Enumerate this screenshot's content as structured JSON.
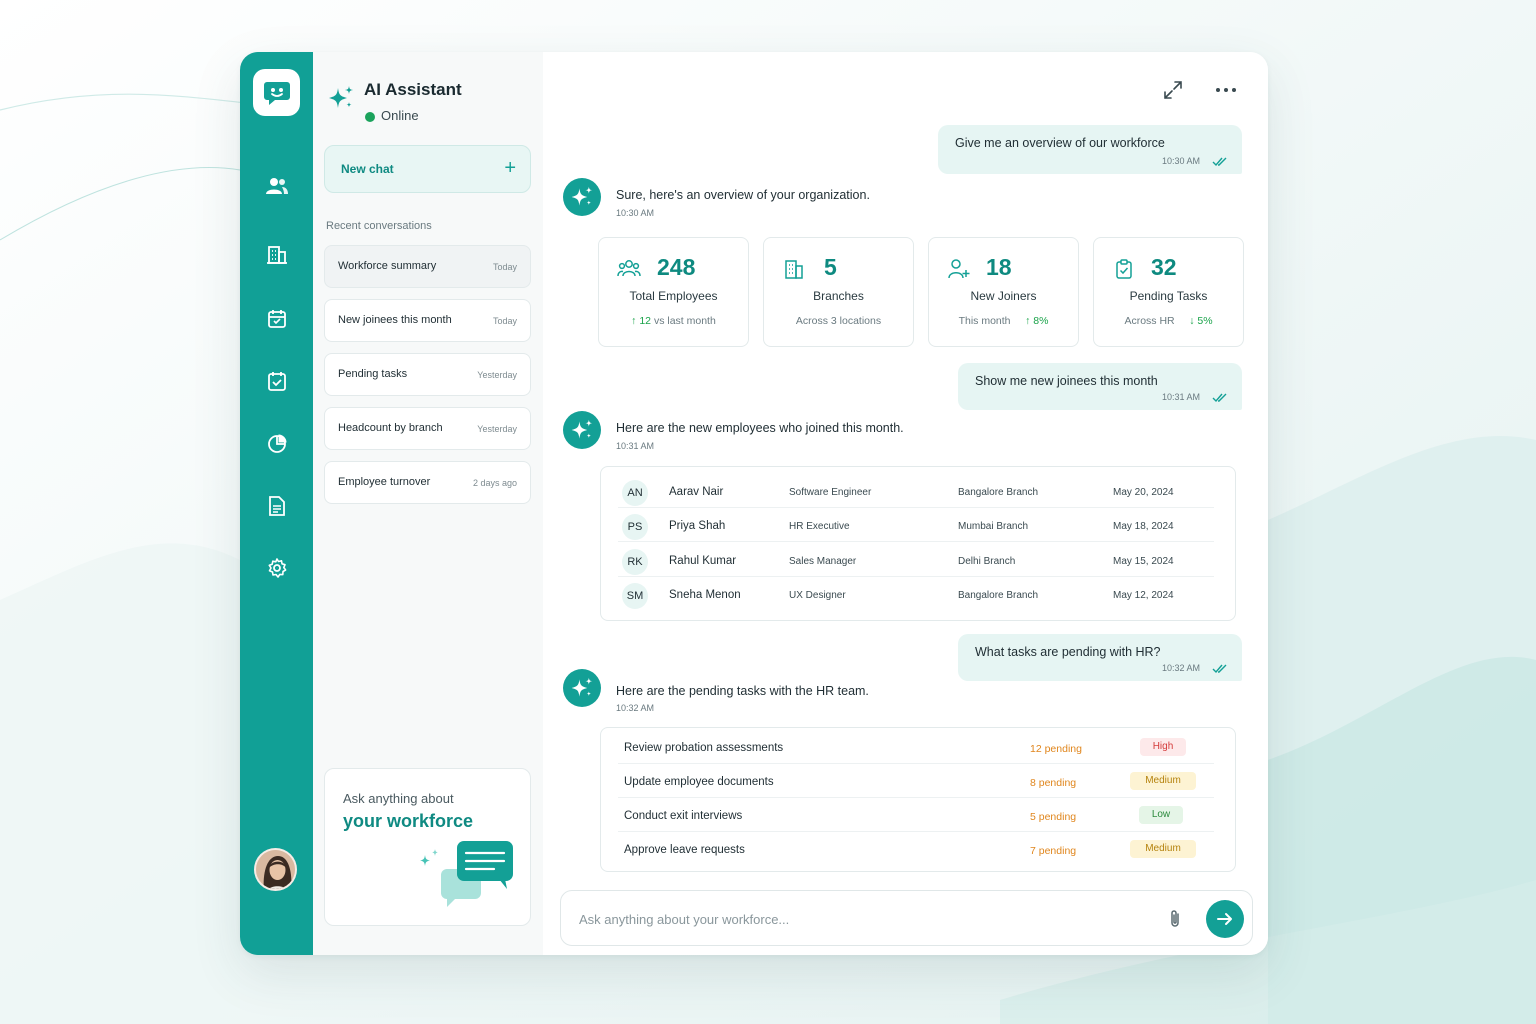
{
  "app": {
    "title": "AI Assistant",
    "status": "Online",
    "accent_color": "#13a096",
    "status_color": "#1ba35c"
  },
  "rail": {
    "items": [
      {
        "icon": "users-icon"
      },
      {
        "icon": "building-icon"
      },
      {
        "icon": "calendar-icon"
      },
      {
        "icon": "tasks-icon"
      },
      {
        "icon": "pie-chart-icon"
      },
      {
        "icon": "document-icon"
      },
      {
        "icon": "settings-icon"
      }
    ]
  },
  "sidebar": {
    "new_chat_label": "New chat",
    "recent_label": "Recent conversations",
    "conversations": [
      {
        "title": "Workforce summary",
        "time": "Today"
      },
      {
        "title": "New joinees this month",
        "time": "Today"
      },
      {
        "title": "Pending tasks",
        "time": "Yesterday"
      },
      {
        "title": "Headcount by branch",
        "time": "Yesterday"
      },
      {
        "title": "Employee turnover",
        "time": "2 days ago"
      }
    ],
    "promo": {
      "line1": "Ask anything about",
      "line2": "your workforce"
    }
  },
  "chat": {
    "m1": {
      "text": "Give me an overview of our workforce",
      "time": "10:30 AM"
    },
    "r1": {
      "text": "Sure, here's an overview of your organization.",
      "time": "10:30 AM"
    },
    "stats": [
      {
        "value": "248",
        "label": "Total Employees",
        "sub_left": "↑ 12",
        "sub_right": "vs last month",
        "icon": "users-icon"
      },
      {
        "value": "5",
        "label": "Branches",
        "sub_left": "Across 3 locations",
        "sub_right": "",
        "icon": "building-icon"
      },
      {
        "value": "18",
        "label": "New Joiners",
        "sub_left": "This month",
        "sub_right": "↑ 8%",
        "icon": "user-plus-icon"
      },
      {
        "value": "32",
        "label": "Pending Tasks",
        "sub_left": "Across HR",
        "sub_right": "↓ 5%",
        "icon": "clipboard-check-icon"
      }
    ],
    "m2": {
      "text": "Show me new joinees this month",
      "time": "10:31 AM"
    },
    "r2": {
      "text": "Here are the new employees who joined this month.",
      "time": "10:31 AM"
    },
    "joinees": [
      {
        "initials": "AN",
        "name": "Aarav Nair",
        "role": "Software Engineer",
        "branch": "Bangalore Branch",
        "date": "May 20, 2024"
      },
      {
        "initials": "PS",
        "name": "Priya Shah",
        "role": "HR Executive",
        "branch": "Mumbai Branch",
        "date": "May 18, 2024"
      },
      {
        "initials": "RK",
        "name": "Rahul Kumar",
        "role": "Sales Manager",
        "branch": "Delhi Branch",
        "date": "May 15, 2024"
      },
      {
        "initials": "SM",
        "name": "Sneha Menon",
        "role": "UX Designer",
        "branch": "Bangalore Branch",
        "date": "May 12, 2024"
      }
    ],
    "m3": {
      "text": "What tasks are pending with HR?",
      "time": "10:32 AM"
    },
    "r3": {
      "text": "Here are the pending tasks with the HR team.",
      "time": "10:32 AM"
    },
    "tasks": [
      {
        "name": "Review probation assessments",
        "pending": "12 pending",
        "priority": "High"
      },
      {
        "name": "Update employee documents",
        "pending": "8 pending",
        "priority": "Medium"
      },
      {
        "name": "Conduct exit interviews",
        "pending": "5 pending",
        "priority": "Low"
      },
      {
        "name": "Approve leave requests",
        "pending": "7 pending",
        "priority": "Medium"
      }
    ]
  },
  "input": {
    "placeholder": "Ask anything about your workforce..."
  }
}
